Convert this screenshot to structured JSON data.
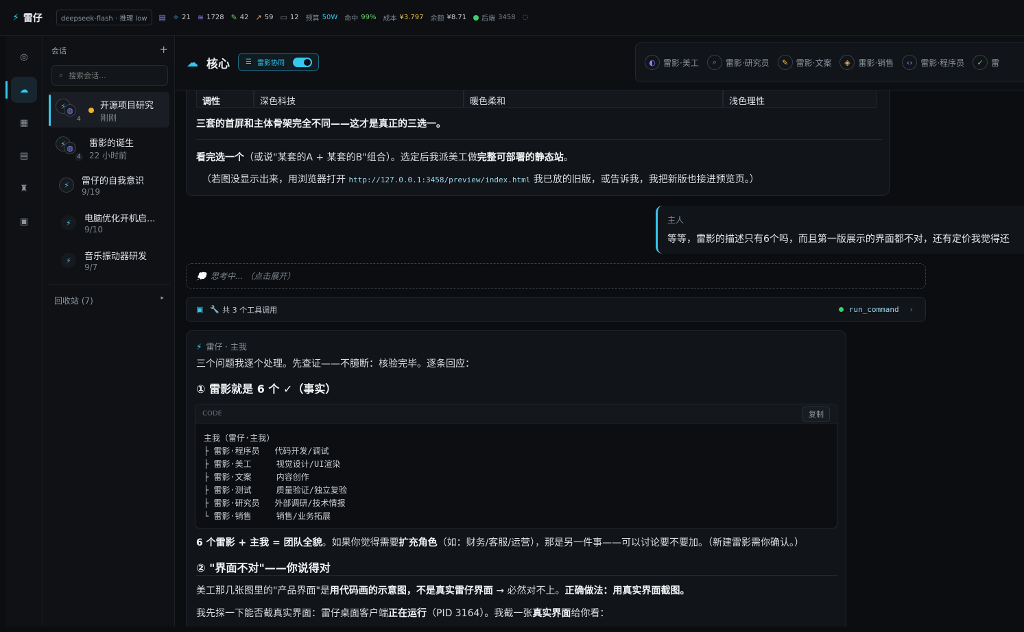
{
  "topbar": {
    "app_name": "雷仔",
    "model": "deepseek-flash · 推理 low",
    "stats": {
      "db": "21",
      "tokens": "1728",
      "edits": "42",
      "trend": "59",
      "messages": "12",
      "budget_label": "预算",
      "budget_value": "50W",
      "hit_label": "命中",
      "hit_value": "99%",
      "cost_label": "成本",
      "cost_value": "¥3.797",
      "balance_label": "余额",
      "balance_value": "¥8.71",
      "backend_label": "后端",
      "backend_value": "3458"
    }
  },
  "sidebar": {
    "header": "会话",
    "add_icon": "+",
    "search_placeholder": "搜索会话...",
    "sessions": [
      {
        "title": "开源项目研究",
        "time": "刚刚",
        "count": "4"
      },
      {
        "title": "雷影的诞生",
        "time": "22 小时前",
        "count": "4"
      },
      {
        "title": "雷仔的自我意识",
        "time": "9/19"
      },
      {
        "title": "电脑优化开机启...",
        "time": "9/10"
      },
      {
        "title": "音乐振动器研发",
        "time": "9/7"
      }
    ],
    "trash": "回收站 (7)",
    "trash_arrow": "▸"
  },
  "header": {
    "title": "核心",
    "collab_label": "雷影协同",
    "agents": [
      "雷影·美工",
      "雷影·研究员",
      "雷影·文案",
      "雷影·销售",
      "雷影·程序员",
      "雷"
    ]
  },
  "prev_message": {
    "table": [
      "调性",
      "深色科技",
      "暖色柔和",
      "浅色理性"
    ],
    "line1": "三套的首屏和主体骨架完全不同——这才是真正的三选一。",
    "line2_bold": "看完选一个",
    "line2_rest": "（或说\"某套的A + 某套的B\"组合）。选定后我派美工做",
    "line2_bold2": "完整可部署的静态站",
    "line2_end": "。",
    "line3_a": "（若图没显示出来，用浏览器打开",
    "line3_url": "http://127.0.0.1:3458/preview/index.html",
    "line3_b": "我已放的旧版，或告诉我，我把新版也接进预览页。）"
  },
  "user_message": {
    "who": "主人",
    "body": "等等，雷影的描述只有6个吗，而且第一版展示的界面都不对，还有定价我觉得还"
  },
  "thinking": "思考中... （点击展开）",
  "tools": {
    "summary": "共 3 个工具调用",
    "command": "run_command"
  },
  "reply": {
    "who": "雷仔 · 主我",
    "intro": "三个问题我逐个处理。先查证——不臆断：核验完毕。逐条回应：",
    "h1": "① 雷影就是 6 个 ✓（事实）",
    "code_label": "CODE",
    "copy_label": "复制",
    "code_lines": [
      "主我（雷仔·主我）",
      "├ 雷影·程序员   代码开发/调试",
      "├ 雷影·美工     视觉设计/UI渲染",
      "├ 雷影·文案     内容创作",
      "├ 雷影·测试     质量验证/独立复验",
      "├ 雷影·研究员   外部调研/技术情报",
      "└ 雷影·销售     销售/业务拓展"
    ],
    "p1_bold": "6 个雷影 + 主我 = 团队全貌",
    "p1_mid": "。如果你觉得需要",
    "p1_bold2": "扩充角色",
    "p1_rest": "（如：财务/客服/运营），那是另一件事——可以讨论要不要加。（新建雷影需你确认。）",
    "h2": "② \"界面不对\"——你说得对",
    "p2_a": "美工那几张图里的\"产品界面\"是",
    "p2_b": "用代码画的示意图，不是真实雷仔界面",
    "p2_c": " → 必然对不上。",
    "p2_d": "正确做法：用真实界面截图。",
    "p3_a": "我先探一下能否截真实界面：雷仔桌面客户端",
    "p3_b": "正在运行",
    "p3_c": "（PID 3164）。我截一张",
    "p3_d": "真实界面",
    "p3_e": "给你看："
  }
}
